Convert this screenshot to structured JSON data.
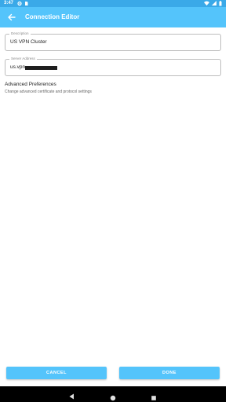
{
  "status_bar": {
    "time": "3:47",
    "left_icons": [
      "settings-icon",
      "sim-icon"
    ],
    "right_icons": [
      "wifi-icon",
      "signal-icon",
      "battery-icon"
    ]
  },
  "app_bar": {
    "title": "Connection Editor",
    "color": "#54c4fb"
  },
  "form": {
    "description": {
      "label": "Description",
      "value": "US VPN Cluster"
    },
    "server_address": {
      "label": "Server Address",
      "value": "us.vpn"
    }
  },
  "advanced": {
    "title": "Advanced Preferences",
    "subtitle": "Change advanced certificate and protocol settings"
  },
  "buttons": {
    "cancel": "CANCEL",
    "done": "DONE"
  },
  "nav_bar": {
    "icons": [
      "back-triangle-icon",
      "home-circle-icon",
      "recents-square-icon"
    ]
  }
}
